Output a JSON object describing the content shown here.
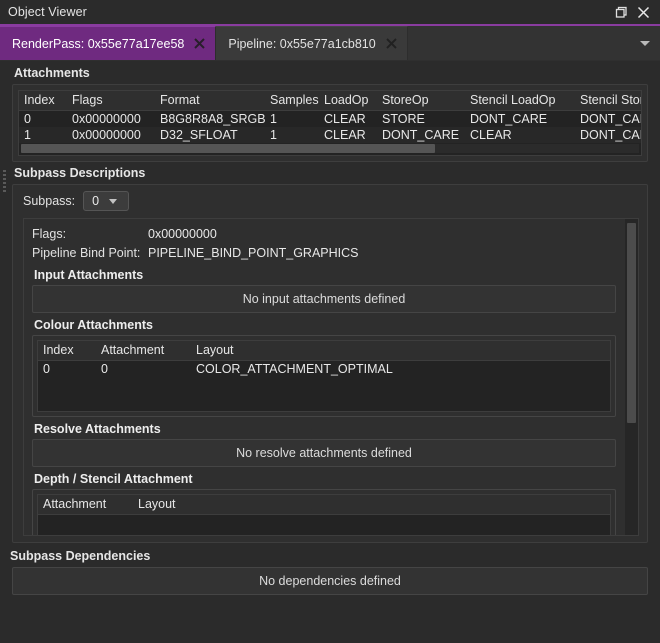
{
  "window": {
    "title": "Object Viewer",
    "restore_icon": "restore-window-icon",
    "close_icon": "close-icon"
  },
  "tabs": {
    "items": [
      {
        "label": "RenderPass: 0x55e77a17ee58",
        "active": true,
        "close_icon": "close-icon"
      },
      {
        "label": "Pipeline: 0x55e77a1cb810",
        "active": false,
        "close_icon": "close-icon"
      }
    ],
    "overflow_icon": "chevron-down-icon"
  },
  "attachments": {
    "title": "Attachments",
    "columns": [
      "Index",
      "Flags",
      "Format",
      "Samples",
      "LoadOp",
      "StoreOp",
      "Stencil LoadOp",
      "Stencil StoreO"
    ],
    "rows": [
      [
        "0",
        "0x00000000",
        "B8G8R8A8_SRGB",
        "1",
        "CLEAR",
        "STORE",
        "DONT_CARE",
        "DONT_CARE"
      ],
      [
        "1",
        "0x00000000",
        "D32_SFLOAT",
        "1",
        "CLEAR",
        "DONT_CARE",
        "CLEAR",
        "DONT_CARE"
      ]
    ]
  },
  "subpass_descriptions": {
    "title": "Subpass Descriptions",
    "selector_label": "Subpass:",
    "selector_value": "0",
    "selector_options": [
      "0"
    ],
    "fields": [
      {
        "key": "Flags:",
        "value": "0x00000000"
      },
      {
        "key": "Pipeline Bind Point:",
        "value": "PIPELINE_BIND_POINT_GRAPHICS"
      }
    ],
    "input_attachments": {
      "heading": "Input Attachments",
      "empty_text": "No input attachments defined"
    },
    "colour_attachments": {
      "heading": "Colour Attachments",
      "columns": [
        "Index",
        "Attachment",
        "Layout"
      ],
      "rows": [
        [
          "0",
          "0",
          "COLOR_ATTACHMENT_OPTIMAL"
        ]
      ]
    },
    "resolve_attachments": {
      "heading": "Resolve Attachments",
      "empty_text": "No resolve attachments defined"
    },
    "depth_stencil_attachment": {
      "heading": "Depth / Stencil Attachment",
      "columns": [
        "Attachment",
        "Layout"
      ]
    }
  },
  "subpass_dependencies": {
    "title": "Subpass Dependencies",
    "empty_text": "No dependencies defined"
  },
  "colors": {
    "accent": "#8a3ca0",
    "active_tab": "#6f2a80",
    "window_bg": "#2b2b2b",
    "table_bg": "#232323"
  }
}
